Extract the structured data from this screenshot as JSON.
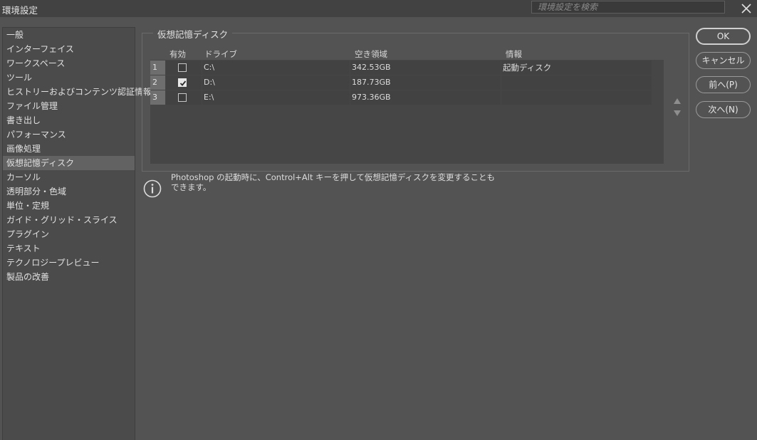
{
  "window": {
    "title": "環境設定"
  },
  "search": {
    "placeholder": "環境設定を検索"
  },
  "sidebar": {
    "items": [
      {
        "label": "一般"
      },
      {
        "label": "インターフェイス"
      },
      {
        "label": "ワークスペース"
      },
      {
        "label": "ツール"
      },
      {
        "label": "ヒストリーおよびコンテンツ認証情報"
      },
      {
        "label": "ファイル管理"
      },
      {
        "label": "書き出し"
      },
      {
        "label": "パフォーマンス"
      },
      {
        "label": "画像処理"
      },
      {
        "label": "仮想記憶ディスク",
        "selected": true
      },
      {
        "label": "カーソル"
      },
      {
        "label": "透明部分・色域"
      },
      {
        "label": "単位・定規"
      },
      {
        "label": "ガイド・グリッド・スライス"
      },
      {
        "label": "プラグイン"
      },
      {
        "label": "テキスト"
      },
      {
        "label": "テクノロジープレビュー"
      },
      {
        "label": "製品の改善"
      }
    ]
  },
  "panel": {
    "group_title": "仮想記憶ディスク",
    "columns": {
      "enabled": "有効",
      "drive": "ドライブ",
      "free_space": "空き領域",
      "info": "情報"
    },
    "rows": [
      {
        "index": "1",
        "enabled": false,
        "drive": "C:\\",
        "free_space": "342.53GB",
        "info": "起動ディスク"
      },
      {
        "index": "2",
        "enabled": true,
        "drive": "D:\\",
        "free_space": "187.73GB",
        "info": ""
      },
      {
        "index": "3",
        "enabled": false,
        "drive": "E:\\",
        "free_space": "973.36GB",
        "info": ""
      }
    ],
    "info_text_line1": "Photoshop の起動時に、Control+Alt キーを押して仮想記憶ディスクを変更することも",
    "info_text_line2": "できます。"
  },
  "buttons": {
    "ok": "OK",
    "cancel": "キャンセル",
    "prev": "前へ(P)",
    "next": "次へ(N)"
  },
  "icons": {
    "close": "close-icon",
    "info": "info-icon",
    "move_up": "triangle-up-icon",
    "move_down": "triangle-down-icon",
    "check": "checkmark-icon"
  },
  "colors": {
    "background": "#535353",
    "titlebar": "#424242",
    "sidebar": "#4b4b4b",
    "selected_item": "#626262"
  }
}
